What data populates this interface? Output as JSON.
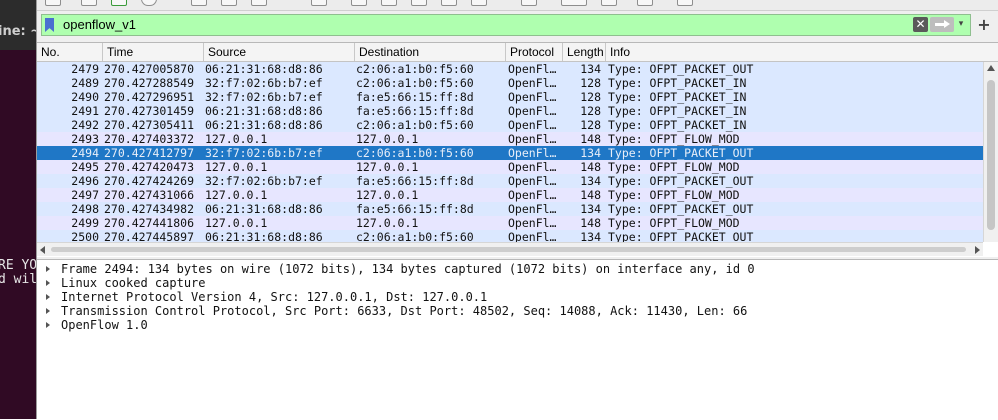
{
  "terminal": {
    "title_fragment": "ine: ~",
    "lines": [
      "RE YO",
      "d wil"
    ]
  },
  "filter": {
    "value": "openflow_v1",
    "clear_glyph": "✕",
    "dropdown_glyph": "▾",
    "add_glyph": "+",
    "background_color": "#afffaf"
  },
  "packet_list": {
    "columns": [
      "No.",
      "Time",
      "Source",
      "Destination",
      "Protocol",
      "Length",
      "Info"
    ],
    "selected_color": "#1f77c6",
    "rows": [
      {
        "no": "2479",
        "time": "270.427005870",
        "src": "06:21:31:68:d8:86",
        "dst": "c2:06:a1:b0:f5:60",
        "proto": "OpenFl…",
        "len": "134",
        "info": "Type: OFPT_PACKET_OUT",
        "style": "tcp"
      },
      {
        "no": "2489",
        "time": "270.427288549",
        "src": "32:f7:02:6b:b7:ef",
        "dst": "c2:06:a1:b0:f5:60",
        "proto": "OpenFl…",
        "len": "128",
        "info": "Type: OFPT_PACKET_IN",
        "style": "tcp"
      },
      {
        "no": "2490",
        "time": "270.427296951",
        "src": "32:f7:02:6b:b7:ef",
        "dst": "fa:e5:66:15:ff:8d",
        "proto": "OpenFl…",
        "len": "128",
        "info": "Type: OFPT_PACKET_IN",
        "style": "tcp"
      },
      {
        "no": "2491",
        "time": "270.427301459",
        "src": "06:21:31:68:d8:86",
        "dst": "fa:e5:66:15:ff:8d",
        "proto": "OpenFl…",
        "len": "128",
        "info": "Type: OFPT_PACKET_IN",
        "style": "tcp"
      },
      {
        "no": "2492",
        "time": "270.427305411",
        "src": "06:21:31:68:d8:86",
        "dst": "c2:06:a1:b0:f5:60",
        "proto": "OpenFl…",
        "len": "128",
        "info": "Type: OFPT_PACKET_IN",
        "style": "tcp"
      },
      {
        "no": "2493",
        "time": "270.427403372",
        "src": "127.0.0.1",
        "dst": "127.0.0.1",
        "proto": "OpenFl…",
        "len": "148",
        "info": "Type: OFPT_FLOW_MOD",
        "style": "in"
      },
      {
        "no": "2494",
        "time": "270.427412797",
        "src": "32:f7:02:6b:b7:ef",
        "dst": "c2:06:a1:b0:f5:60",
        "proto": "OpenFl…",
        "len": "134",
        "info": "Type: OFPT_PACKET_OUT",
        "style": "sel"
      },
      {
        "no": "2495",
        "time": "270.427420473",
        "src": "127.0.0.1",
        "dst": "127.0.0.1",
        "proto": "OpenFl…",
        "len": "148",
        "info": "Type: OFPT_FLOW_MOD",
        "style": "in"
      },
      {
        "no": "2496",
        "time": "270.427424269",
        "src": "32:f7:02:6b:b7:ef",
        "dst": "fa:e5:66:15:ff:8d",
        "proto": "OpenFl…",
        "len": "134",
        "info": "Type: OFPT_PACKET_OUT",
        "style": "tcp"
      },
      {
        "no": "2497",
        "time": "270.427431066",
        "src": "127.0.0.1",
        "dst": "127.0.0.1",
        "proto": "OpenFl…",
        "len": "148",
        "info": "Type: OFPT_FLOW_MOD",
        "style": "in"
      },
      {
        "no": "2498",
        "time": "270.427434982",
        "src": "06:21:31:68:d8:86",
        "dst": "fa:e5:66:15:ff:8d",
        "proto": "OpenFl…",
        "len": "134",
        "info": "Type: OFPT_PACKET_OUT",
        "style": "tcp"
      },
      {
        "no": "2499",
        "time": "270.427441806",
        "src": "127.0.0.1",
        "dst": "127.0.0.1",
        "proto": "OpenFl…",
        "len": "148",
        "info": "Type: OFPT_FLOW_MOD",
        "style": "in"
      },
      {
        "no": "2500",
        "time": "270.427445897",
        "src": "06:21:31:68:d8:86",
        "dst": "c2:06:a1:b0:f5:60",
        "proto": "OpenFl…",
        "len": "134",
        "info": "Type: OFPT_PACKET_OUT",
        "style": "tcp"
      }
    ]
  },
  "details": {
    "rows": [
      "Frame 2494: 134 bytes on wire (1072 bits), 134 bytes captured (1072 bits) on interface any, id 0",
      "Linux cooked capture",
      "Internet Protocol Version 4, Src: 127.0.0.1, Dst: 127.0.0.1",
      "Transmission Control Protocol, Src Port: 6633, Dst Port: 48502, Seq: 14088, Ack: 11430, Len: 66",
      "OpenFlow 1.0"
    ]
  }
}
